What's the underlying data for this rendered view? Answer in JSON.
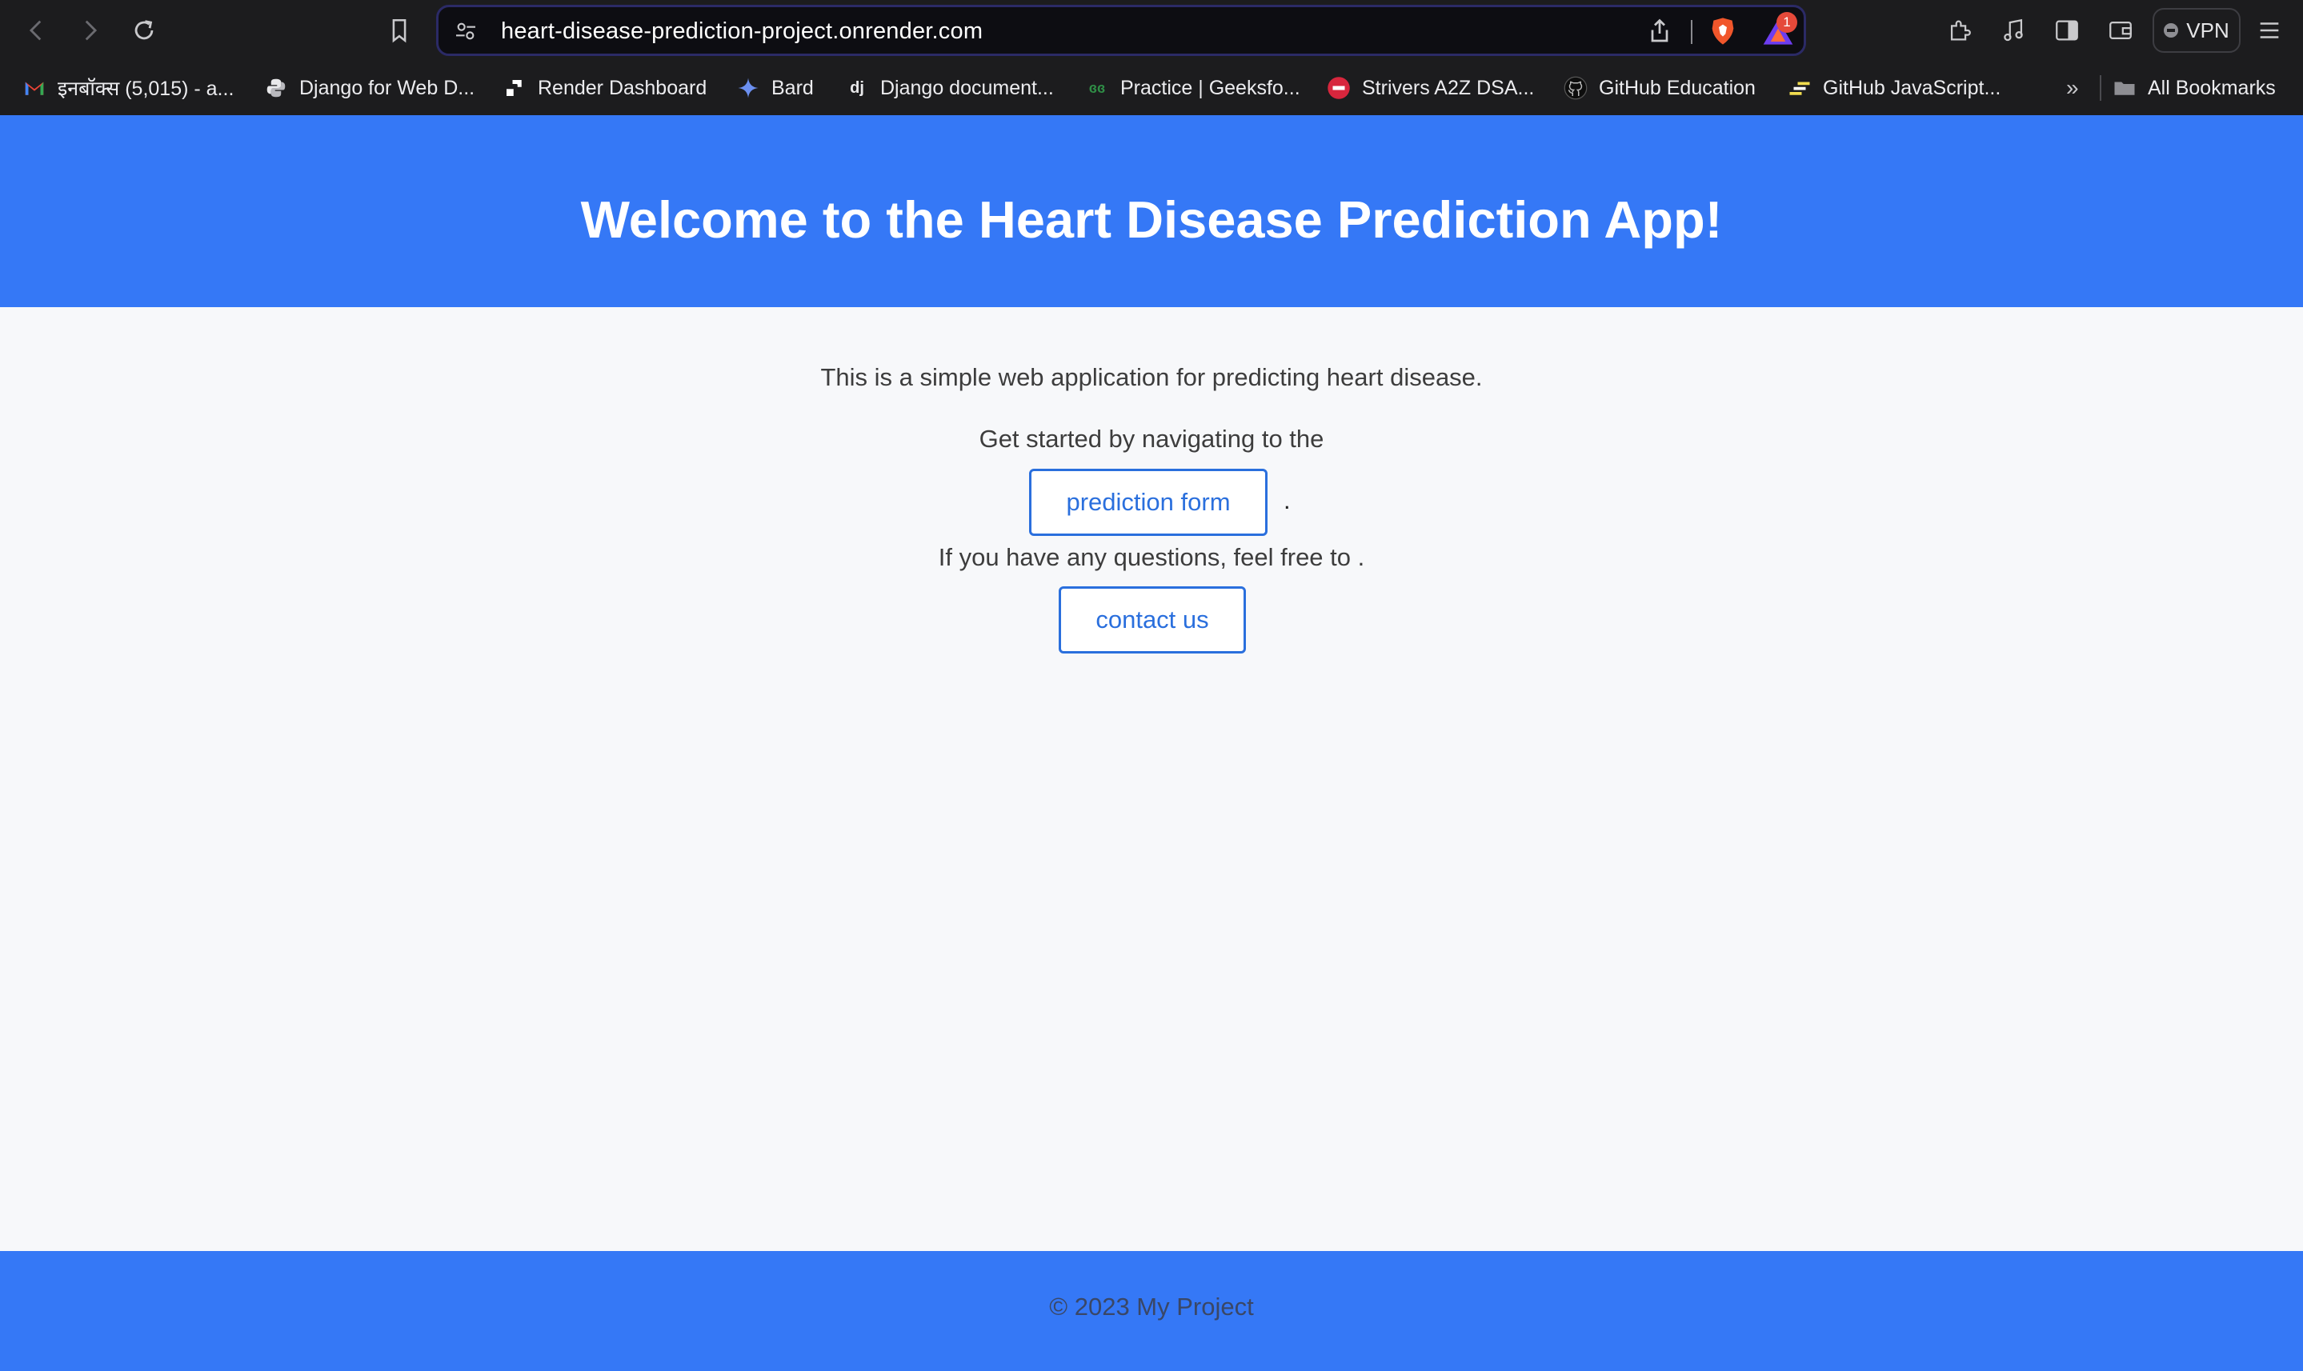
{
  "browser": {
    "url": "heart-disease-prediction-project.onrender.com",
    "rewards_badge": "1",
    "vpn_label": "VPN",
    "bookmarks": [
      {
        "label": "इनबॉक्स (5,015) - a...",
        "icon": "gmail-icon"
      },
      {
        "label": "Django for Web D...",
        "icon": "python-icon"
      },
      {
        "label": "Render Dashboard",
        "icon": "render-icon"
      },
      {
        "label": "Bard",
        "icon": "bard-sparkle-icon"
      },
      {
        "label": "Django document...",
        "icon": "django-icon"
      },
      {
        "label": "Practice | Geeksfo...",
        "icon": "geeksforgeeks-icon"
      },
      {
        "label": "Strivers A2Z DSA...",
        "icon": "tuf-icon"
      },
      {
        "label": "GitHub Education",
        "icon": "github-icon"
      },
      {
        "label": "GitHub JavaScript...",
        "icon": "github-js-icon"
      }
    ],
    "overflow_label": "»",
    "all_bookmarks_label": "All Bookmarks"
  },
  "page": {
    "title": "Welcome to the Heart Disease Prediction App!",
    "intro": "This is a simple web application for predicting heart disease.",
    "get_started": "Get started by navigating to the",
    "prediction_link": "prediction form",
    "period": ".",
    "questions": "If you have any questions, feel free to .",
    "contact_link": "contact us",
    "footer": "© 2023 My Project"
  },
  "colors": {
    "header_bg": "#3578f6",
    "link": "#2a6fdd",
    "page_bg": "#f7f8fa"
  }
}
